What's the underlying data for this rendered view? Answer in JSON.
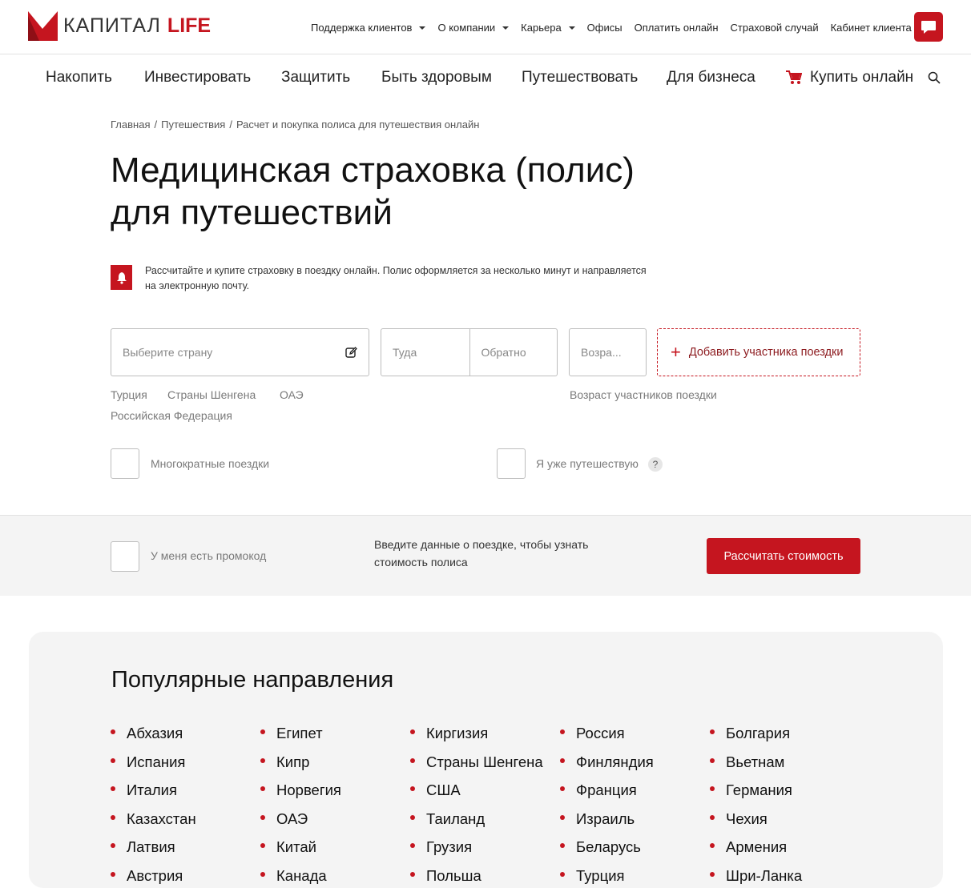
{
  "brand": {
    "logo_text": "КАПИТАЛ",
    "logo_accent": "LIFE",
    "accent_color": "#c5151f"
  },
  "topnav": {
    "items": [
      {
        "label": "Поддержка клиентов",
        "dropdown": true
      },
      {
        "label": "О компании",
        "dropdown": true
      },
      {
        "label": "Карьера",
        "dropdown": true
      },
      {
        "label": "Офисы",
        "dropdown": false
      },
      {
        "label": "Оплатить онлайн",
        "dropdown": false
      },
      {
        "label": "Страховой случай",
        "dropdown": false
      },
      {
        "label": "Кабинет клиента",
        "dropdown": false
      }
    ]
  },
  "mainnav": {
    "items": [
      "Накопить",
      "Инвестировать",
      "Защитить",
      "Быть здоровым",
      "Путешествовать",
      "Для бизнеса"
    ],
    "buy_online": "Купить онлайн"
  },
  "breadcrumb": [
    "Главная",
    "Путешествия",
    "Расчет и покупка полиса для путешествия онлайн"
  ],
  "page": {
    "title_line1": "Медицинская страховка (полис)",
    "title_line2": "для путешествий",
    "notice": "Рассчитайте и купите страховку в поездку онлайн. Полис оформляется за несколько минут и направляется на электронную почту."
  },
  "form": {
    "country_placeholder": "Выберите страну",
    "date_from_placeholder": "Туда",
    "date_to_placeholder": "Обратно",
    "age_placeholder": "Возра...",
    "add_participant": "Добавить участника поездки",
    "quick_countries": [
      "Турция",
      "Страны Шенгена",
      "ОАЭ",
      "Российская Федерация"
    ],
    "age_hint": "Возраст участников поездки",
    "multi_trip_label": "Многократные поездки",
    "already_travelling_label": "Я уже путешествую",
    "help_glyph": "?",
    "promo_label": "У меня есть промокод",
    "promo_note": "Введите данные о поездке, чтобы узнать стоимость полиса",
    "calc_button": "Рассчитать стоимость"
  },
  "popular": {
    "title": "Популярные направления",
    "columns": [
      [
        "Абхазия",
        "Испания",
        "Италия",
        "Казахстан",
        "Латвия",
        "Австрия"
      ],
      [
        "Египет",
        "Кипр",
        "Норвегия",
        "ОАЭ",
        "Китай",
        "Канада"
      ],
      [
        "Киргизия",
        "Страны Шенгена",
        "США",
        "Таиланд",
        "Грузия",
        "Польша"
      ],
      [
        "Россия",
        "Финляндия",
        "Франция",
        "Израиль",
        "Беларусь",
        "Турция"
      ],
      [
        "Болгария",
        "Вьетнам",
        "Германия",
        "Чехия",
        "Армения",
        "Шри-Ланка"
      ]
    ]
  }
}
